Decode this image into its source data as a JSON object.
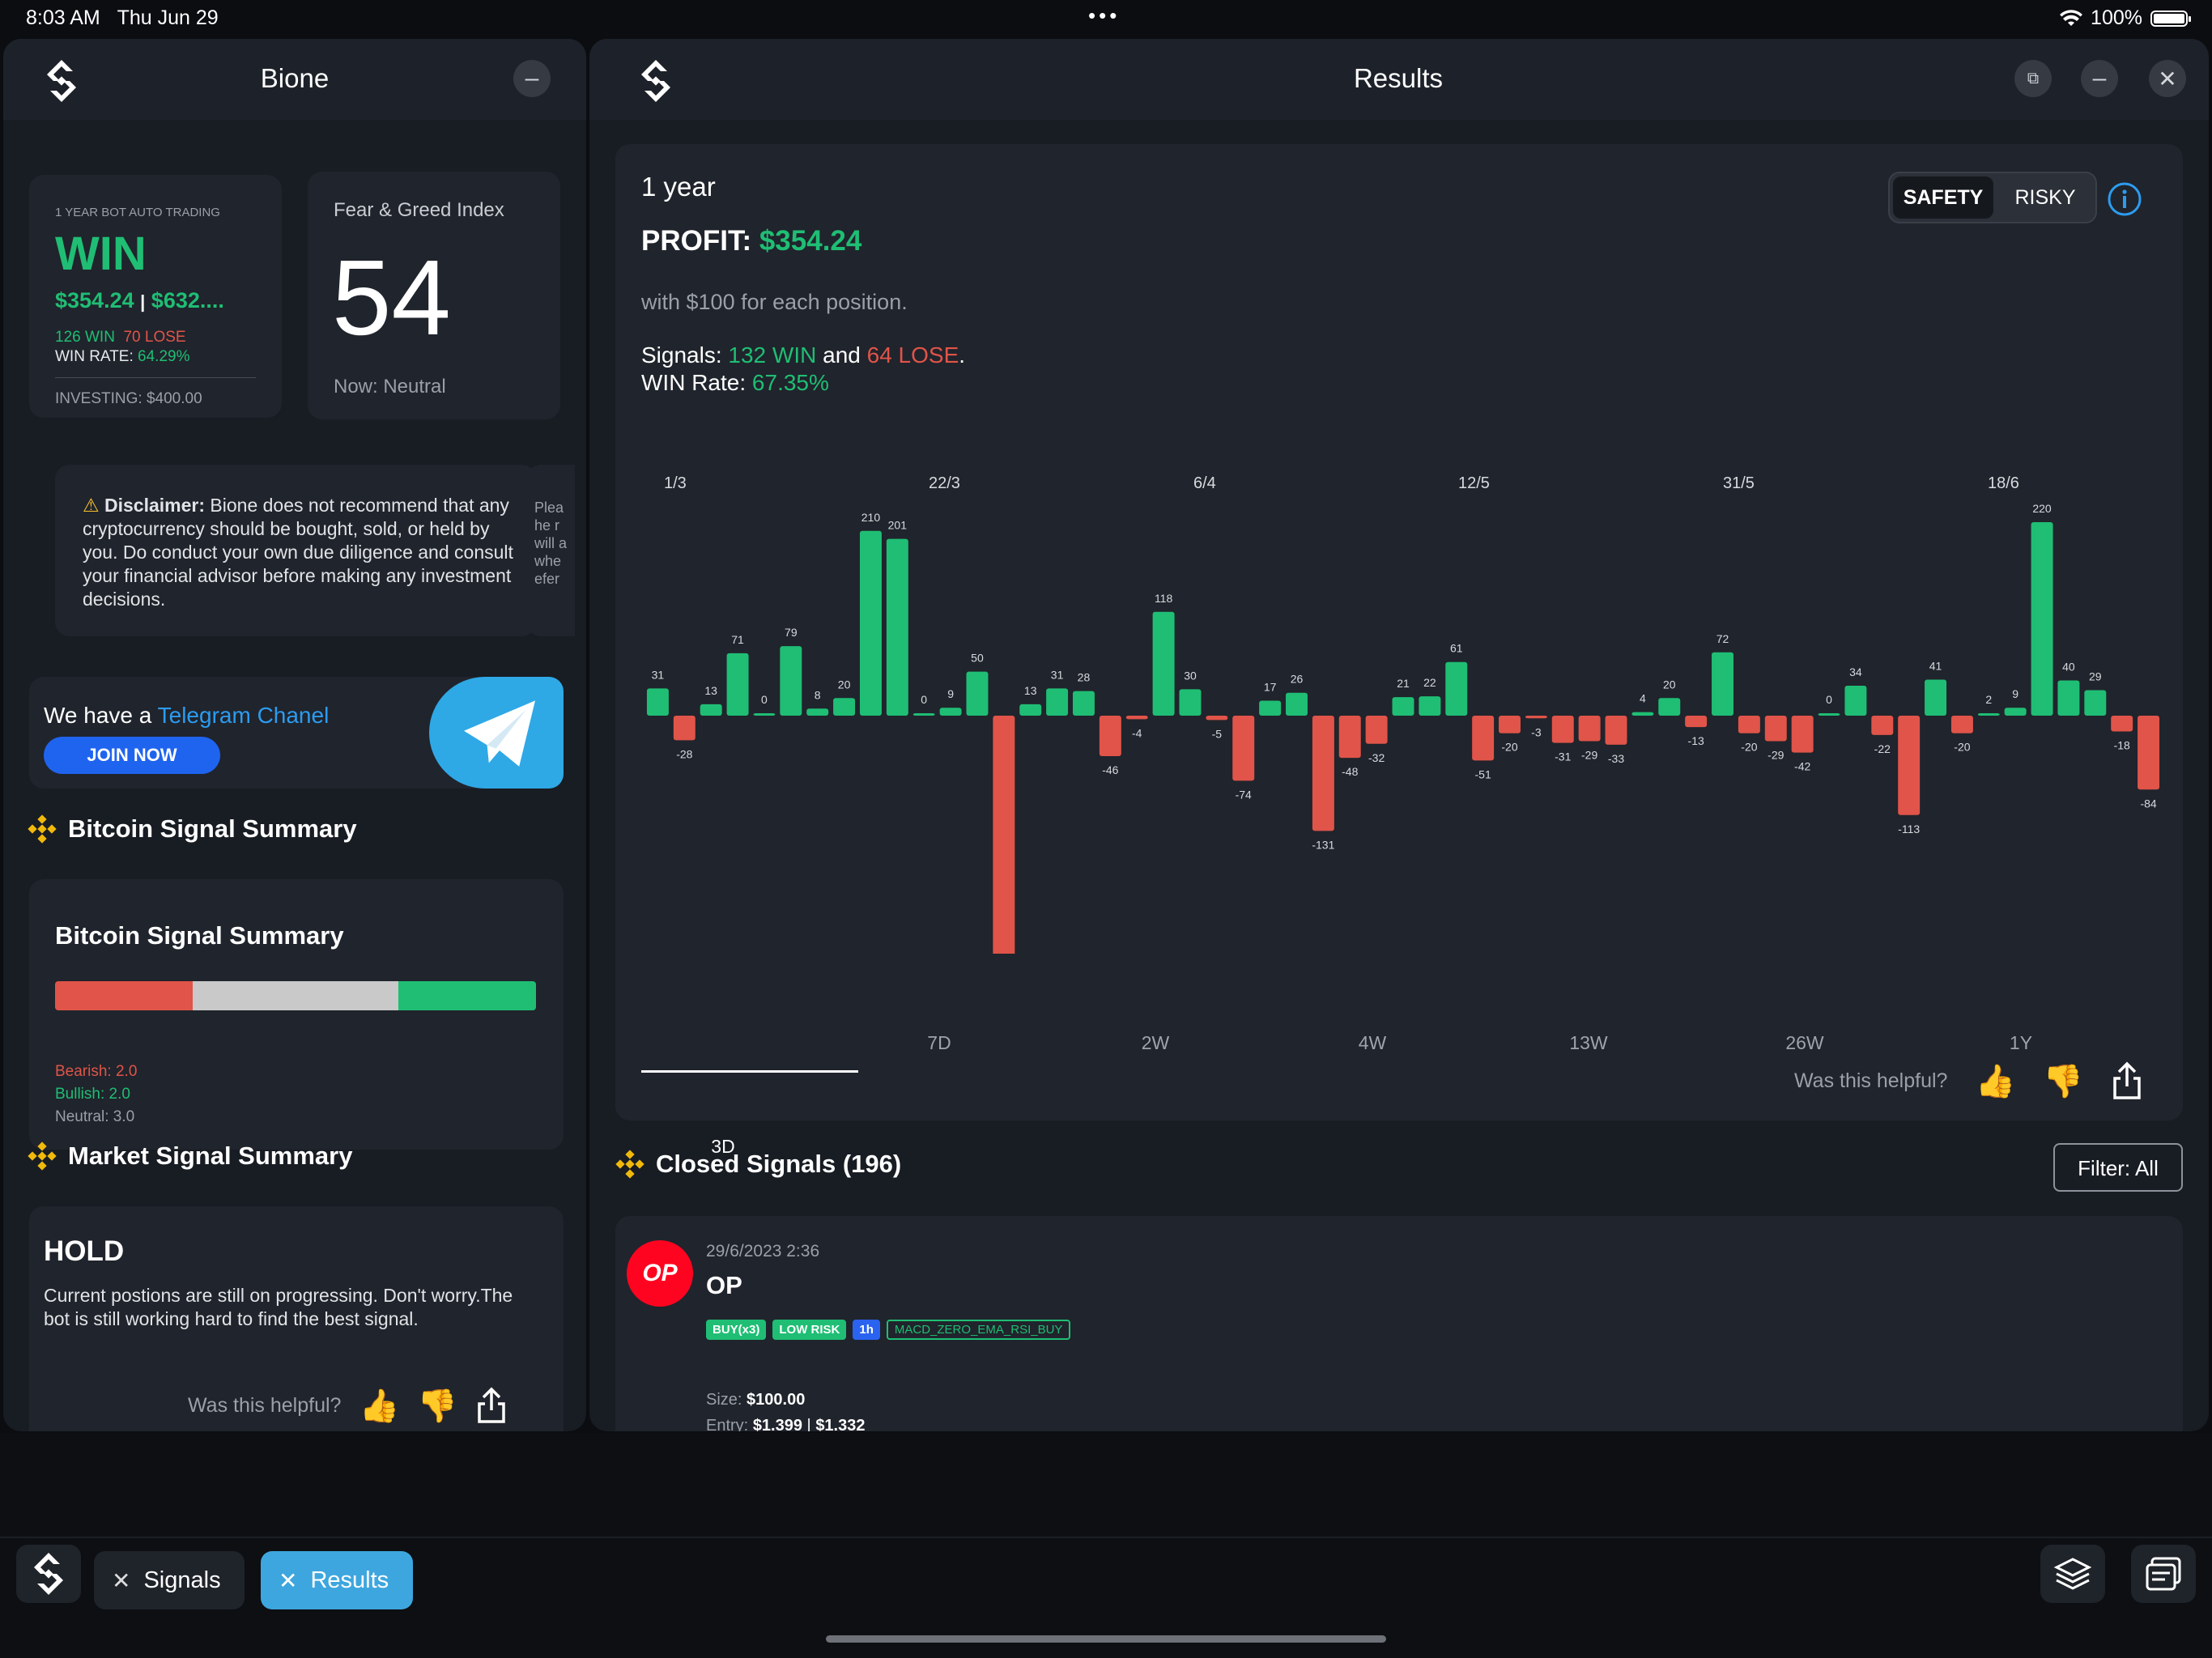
{
  "status_bar": {
    "time": "8:03 AM",
    "date": "Thu Jun 29",
    "battery": "100%"
  },
  "left_panel": {
    "title": "Bione",
    "bot_card": {
      "caption": "1 YEAR BOT AUTO TRADING",
      "result": "WIN",
      "profit": "$354.24",
      "separator": "|",
      "profit_alt": "$632....",
      "wins": "126 WIN",
      "loses": "70 LOSE",
      "win_rate_label": "WIN RATE:",
      "win_rate": "64.29%",
      "investing": "INVESTING: $400.00"
    },
    "fear_greed": {
      "title": "Fear & Greed Index",
      "value": "54",
      "now": "Now: Neutral"
    },
    "disclaimer": {
      "label": "Disclaimer:",
      "text": "Bione does not recommend that any cryptocurrency should be bought, sold, or held by you. Do conduct your own due diligence and consult your financial advisor before making any investment decisions.",
      "peek": [
        "Plea",
        "he r",
        "will a",
        "whe",
        "efer"
      ]
    },
    "telegram": {
      "prefix": "We have a",
      "link": "Telegram Chanel",
      "button": "JOIN NOW"
    },
    "bitcoin_section_title": "Bitcoin Signal Summary",
    "bitcoin_card": {
      "title": "Bitcoin Signal Summary",
      "bearish": "Bearish: 2.0",
      "bullish": "Bullish: 2.0",
      "neutral": "Neutral: 3.0",
      "bearish_value": 2.0,
      "neutral_value": 3.0,
      "bullish_value": 2.0
    },
    "market_section_title": "Market Signal Summary",
    "market_card": {
      "status": "HOLD",
      "text": "Current postions are still on progressing. Don't worry.The bot is still working hard to find the best signal.",
      "helpful": "Was this helpful?"
    }
  },
  "right_panel": {
    "title": "Results",
    "period": "1 year",
    "profit_label": "PROFIT:",
    "profit_value": "$354.24",
    "note": "with $100 for each position.",
    "signals_label": "Signals:",
    "signals_win": "132 WIN",
    "signals_and": "and",
    "signals_lose": "64 LOSE",
    "signals_end": ".",
    "winrate_label": "WIN Rate:",
    "winrate_value": "67.35%",
    "toggle": {
      "safety": "SAFETY",
      "risky": "RISKY"
    },
    "tabs": [
      "3D",
      "7D",
      "2W",
      "4W",
      "13W",
      "26W",
      "1Y"
    ],
    "active_tab": "3D",
    "helpful": "Was this helpful?",
    "closed_title": "Closed Signals (196)",
    "filter": "Filter: All",
    "signal": {
      "logo_text": "OP",
      "datetime": "29/6/2023 2:36",
      "symbol": "OP",
      "tags": [
        "BUY(x3)",
        "LOW RISK",
        "1h",
        "MACD_ZERO_EMA_RSI_BUY"
      ],
      "size_label": "Size:",
      "size_value": "$100.00",
      "entry_label": "Entry:",
      "entry_value": "$1.399",
      "entry_sep": "|",
      "entry_value2": "$1.332"
    }
  },
  "taskbar": {
    "signals": "Signals",
    "results": "Results"
  },
  "colors": {
    "win": "#1fbe74",
    "lose": "#e05449",
    "accent": "#2c9cf0",
    "brand": "#f0b90b"
  },
  "chart_data": {
    "type": "bar",
    "x_labels": [
      "1/3",
      "22/3",
      "6/4",
      "12/5",
      "31/5",
      "18/6"
    ],
    "values": [
      31,
      -28,
      13,
      71,
      0,
      79,
      8,
      20,
      210,
      201,
      0,
      9,
      50,
      -277,
      13,
      31,
      28,
      -46,
      -4,
      118,
      30,
      -5,
      -74,
      17,
      26,
      -131,
      -48,
      -32,
      21,
      22,
      61,
      -51,
      -20,
      -3,
      -31,
      -29,
      -33,
      4,
      20,
      -13,
      72,
      -20,
      -29,
      -42,
      0,
      34,
      -22,
      -113,
      41,
      -20,
      2,
      9,
      220,
      40,
      29,
      -18,
      -84
    ]
  }
}
